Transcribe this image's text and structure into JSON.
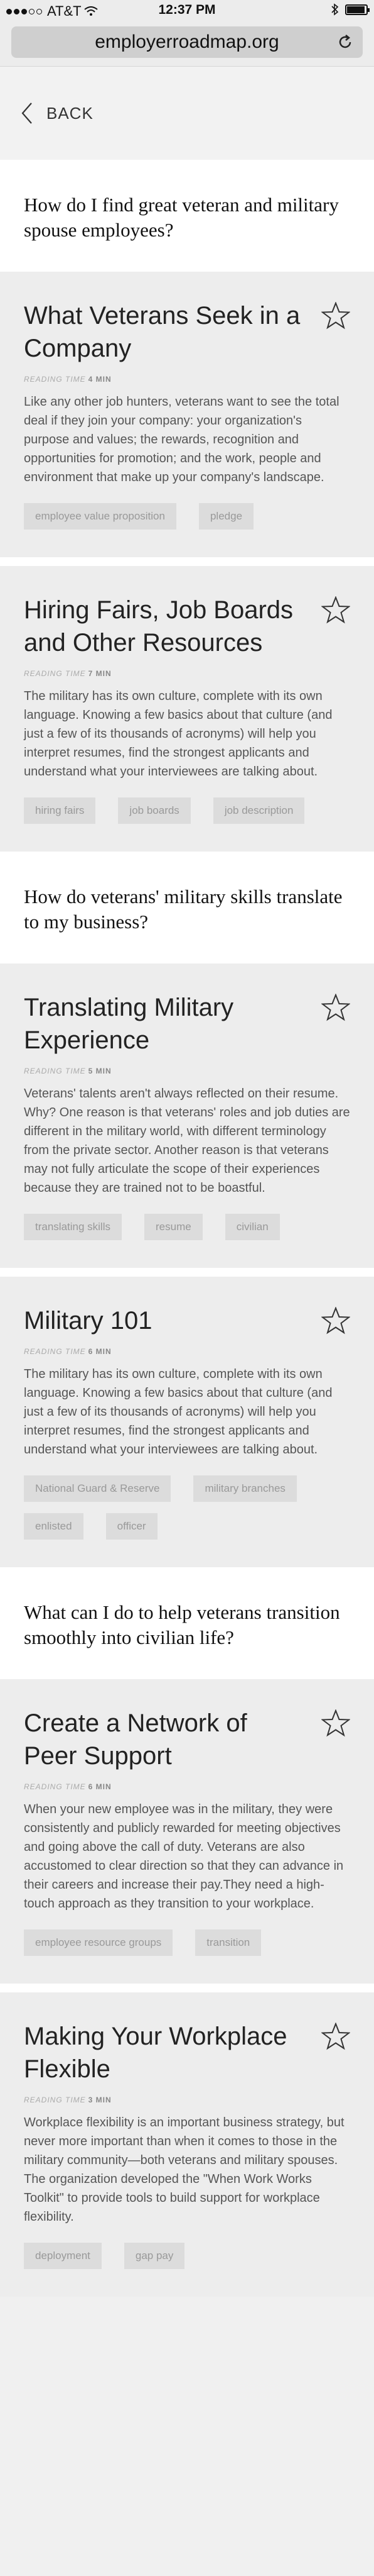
{
  "status_bar": {
    "carrier": "AT&T",
    "time": "12:37 PM"
  },
  "browser": {
    "url": "employerroadmap.org"
  },
  "nav": {
    "back_label": "BACK"
  },
  "reading_label": "READING TIME",
  "sections": [
    {
      "question": "How do I find great veteran and military spouse employees?",
      "cards": [
        {
          "title": "What Veterans Seek in a Company",
          "reading_time": "4 MIN",
          "description": "Like any other job hunters, veterans want to see the total deal if they join your company: your organization's purpose and values; the rewards, recognition and opportunities for promotion; and the work, people and environment that make up your company's landscape.",
          "tags": [
            "employee value proposition",
            "pledge"
          ]
        },
        {
          "title": "Hiring Fairs, Job Boards and Other Resources",
          "reading_time": "7 MIN",
          "description": "The military has its own culture, complete with its own language. Knowing a few basics about that culture (and just a few of its thousands of acronyms) will help you interpret resumes, find the strongest applicants and understand what your interviewees are talking about.",
          "tags": [
            "hiring fairs",
            "job boards",
            "job description"
          ]
        }
      ]
    },
    {
      "question": "How do veterans' military skills translate to my business?",
      "cards": [
        {
          "title": "Translating Military Experience",
          "reading_time": "5 MIN",
          "description": "Veterans' talents aren't always reflected on their resume. Why? One reason is that veterans' roles and job duties are different in the military world, with different terminology from the private sector. Another reason is that veterans may not fully articulate the scope of their experiences because they are trained not to be boastful.",
          "tags": [
            "translating skills",
            "resume",
            "civilian"
          ]
        },
        {
          "title": "Military 101",
          "reading_time": "6 MIN",
          "description": "The military has its own culture, complete with its own language. Knowing a few basics about that culture (and just a few of its thousands of acronyms) will help you interpret resumes, find the strongest applicants and understand what your interviewees are talking about.",
          "tags": [
            "National Guard & Reserve",
            "military branches",
            "enlisted",
            "officer"
          ]
        }
      ]
    },
    {
      "question": "What can I do to help veterans transition smoothly into civilian life?",
      "cards": [
        {
          "title": "Create a Network of Peer Support",
          "reading_time": "6 MIN",
          "description": "When your new employee was in the military, they were consistently and publicly rewarded for meeting objectives and going above the call of duty. Veterans are also accustomed to clear direction so that they can advance in their careers and increase their pay.They need a high-touch approach as they transition to your workplace.",
          "tags": [
            "employee resource groups",
            "transition"
          ]
        },
        {
          "title": "Making Your Workplace Flexible",
          "reading_time": "3 MIN",
          "description": "Workplace flexibility is an important business strategy, but never more important than when it comes to those in the military community—both veterans and military spouses. The organization developed the \"When Work Works Toolkit\" to provide tools to build support for workplace flexibility.",
          "tags": [
            "deployment",
            "gap pay"
          ]
        }
      ]
    }
  ]
}
